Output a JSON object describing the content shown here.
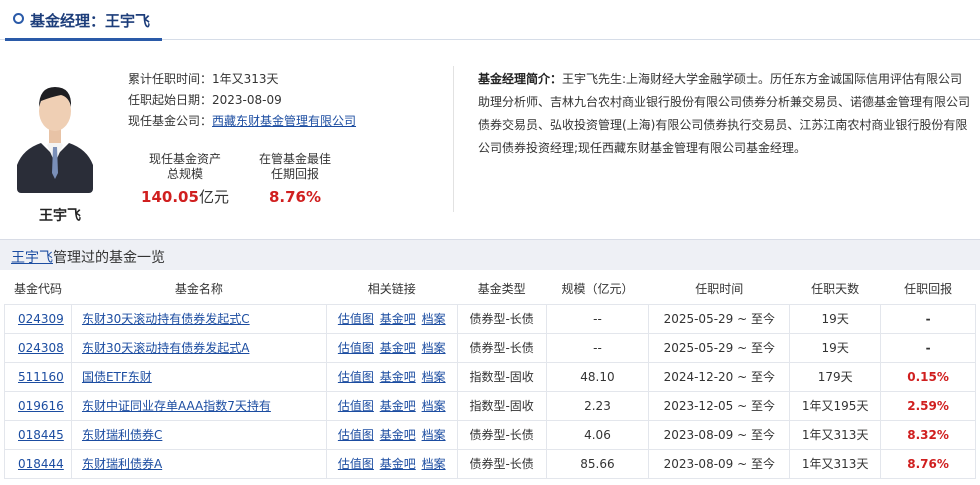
{
  "header": {
    "title": "基金经理：王宇飞"
  },
  "profile": {
    "name": "王宇飞",
    "tenure_label": "累计任职时间：",
    "tenure_value": "1年又313天",
    "start_label": "任职起始日期：",
    "start_value": "2023-08-09",
    "company_label": "现任基金公司：",
    "company_value": "西藏东财基金管理有限公司",
    "assets_label_1": "现任基金资产",
    "assets_label_2": "总规模",
    "assets_value": "140.05",
    "assets_unit": "亿元",
    "return_label_1": "在管基金最佳",
    "return_label_2": "任期回报",
    "return_value": "8.76%"
  },
  "bio": {
    "label": "基金经理简介：",
    "text": "王宇飞先生:上海财经大学金融学硕士。历任东方金诚国际信用评估有限公司助理分析师、吉林九台农村商业银行股份有限公司债券分析兼交易员、诺德基金管理有限公司债券交易员、弘收投资管理(上海)有限公司债券执行交易员、江苏江南农村商业银行股份有限公司债券投资经理;现任西藏东财基金管理有限公司基金经理。"
  },
  "list": {
    "name_link": "王宇飞",
    "title": "管理过的基金一览"
  },
  "table": {
    "headers": [
      "基金代码",
      "基金名称",
      "相关链接",
      "基金类型",
      "规模（亿元）",
      "任职时间",
      "任职天数",
      "任职回报"
    ],
    "link_labels": [
      "估值图",
      "基金吧",
      "档案"
    ],
    "rows": [
      {
        "code": "024309",
        "name": "东财30天滚动持有债券发起式C",
        "type": "债券型-长债",
        "size": "--",
        "period": "2025-05-29 ~ 至今",
        "days": "19天",
        "ret": "-",
        "positive": false
      },
      {
        "code": "024308",
        "name": "东财30天滚动持有债券发起式A",
        "type": "债券型-长债",
        "size": "--",
        "period": "2025-05-29 ~ 至今",
        "days": "19天",
        "ret": "-",
        "positive": false
      },
      {
        "code": "511160",
        "name": "国债ETF东财",
        "type": "指数型-固收",
        "size": "48.10",
        "period": "2024-12-20 ~ 至今",
        "days": "179天",
        "ret": "0.15%",
        "positive": true
      },
      {
        "code": "019616",
        "name": "东财中证同业存单AAA指数7天持有",
        "type": "指数型-固收",
        "size": "2.23",
        "period": "2023-12-05 ~ 至今",
        "days": "1年又195天",
        "ret": "2.59%",
        "positive": true
      },
      {
        "code": "018445",
        "name": "东财瑞利债券C",
        "type": "债券型-长债",
        "size": "4.06",
        "period": "2023-08-09 ~ 至今",
        "days": "1年又313天",
        "ret": "8.32%",
        "positive": true
      },
      {
        "code": "018444",
        "name": "东财瑞利债券A",
        "type": "债券型-长债",
        "size": "85.66",
        "period": "2023-08-09 ~ 至今",
        "days": "1年又313天",
        "ret": "8.76%",
        "positive": true
      }
    ]
  },
  "colors": {
    "accent": "#1c3d7a",
    "link": "#1c4da1",
    "positive": "#d01f1f"
  }
}
